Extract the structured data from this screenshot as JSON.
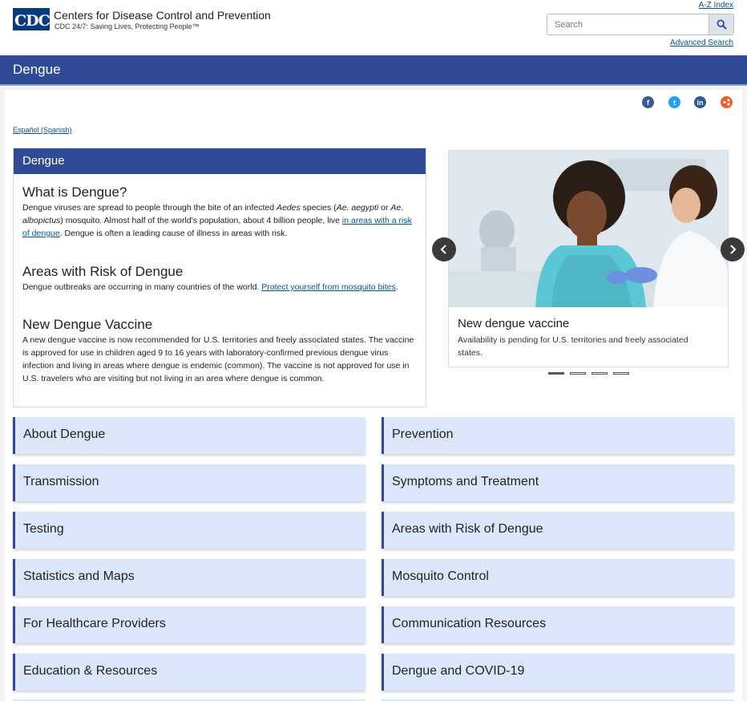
{
  "header": {
    "logo_text": "CDC",
    "org_name": "Centers for Disease Control and Prevention",
    "tagline": "CDC 24/7: Saving Lives, Protecting People™",
    "az_index": "A-Z Index",
    "search_placeholder": "Search",
    "advanced_search": "Advanced Search"
  },
  "page_title": "Dengue",
  "social": [
    {
      "name": "facebook",
      "color": "#3b5998"
    },
    {
      "name": "twitter",
      "color": "#1da1f2"
    },
    {
      "name": "linkedin",
      "color": "#2e5a97"
    },
    {
      "name": "syndicate",
      "color": "#ef5b2a"
    }
  ],
  "espanol_link": "Español (Spanish)",
  "info_card": {
    "heading": "Dengue",
    "what_title": "What is Dengue?",
    "what_text_1": "Dengue viruses are spread to people through the bite of an infected ",
    "what_em_1": "Aedes",
    "what_text_2": " species (",
    "what_em_2": "Ae. aegypti",
    "what_text_3": " or ",
    "what_em_3": "Ae. albopictus",
    "what_text_4": ") mosquito. Almost half of the world's population, about 4 billion people, live ",
    "what_link": "in areas with a risk of dengue",
    "what_text_5": ". Dengue is often a leading cause of illness in areas with risk.",
    "areas_title": "Areas with Risk of Dengue",
    "areas_text": "Dengue outbreaks are occurring in many countries of the world. ",
    "areas_link": "Protect yourself from mosquito bites",
    "areas_end": ".",
    "vaccine_title": "New Dengue Vaccine",
    "vaccine_text": "A new dengue vaccine is now recommended for U.S. territories and freely associated states. The vaccine is approved for use in children aged 9 to 16 years with laboratory-confirmed previous dengue virus infection and living in areas where dengue is endemic (common). The vaccine is not approved for use in U.S. travelers who are visiting but not living in an area where dengue is common."
  },
  "carousel": {
    "caption_title": "New dengue vaccine",
    "caption_text": "Availability is pending for U.S. territories and freely associated states.",
    "active_index": 0,
    "slide_count": 4
  },
  "nav_tiles": [
    "About Dengue",
    "Prevention",
    "Transmission",
    "Symptoms and Treatment",
    "Testing",
    "Areas with Risk of Dengue",
    "Statistics and Maps",
    "Mosquito Control",
    "For Healthcare Providers",
    "Communication Resources",
    "Education & Resources",
    "Dengue and COVID-19"
  ]
}
